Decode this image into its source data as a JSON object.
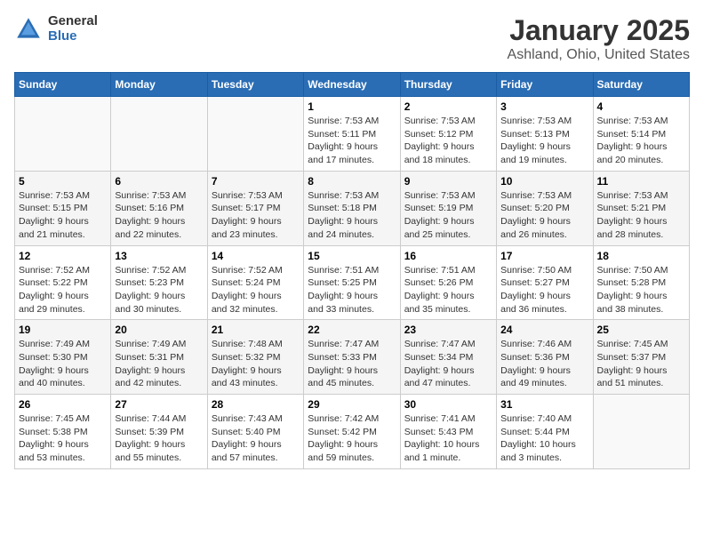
{
  "header": {
    "logo": {
      "general": "General",
      "blue": "Blue"
    },
    "title": "January 2025",
    "subtitle": "Ashland, Ohio, United States"
  },
  "weekdays": [
    "Sunday",
    "Monday",
    "Tuesday",
    "Wednesday",
    "Thursday",
    "Friday",
    "Saturday"
  ],
  "weeks": [
    [
      {
        "day": "",
        "info": ""
      },
      {
        "day": "",
        "info": ""
      },
      {
        "day": "",
        "info": ""
      },
      {
        "day": "1",
        "info": "Sunrise: 7:53 AM\nSunset: 5:11 PM\nDaylight: 9 hours\nand 17 minutes."
      },
      {
        "day": "2",
        "info": "Sunrise: 7:53 AM\nSunset: 5:12 PM\nDaylight: 9 hours\nand 18 minutes."
      },
      {
        "day": "3",
        "info": "Sunrise: 7:53 AM\nSunset: 5:13 PM\nDaylight: 9 hours\nand 19 minutes."
      },
      {
        "day": "4",
        "info": "Sunrise: 7:53 AM\nSunset: 5:14 PM\nDaylight: 9 hours\nand 20 minutes."
      }
    ],
    [
      {
        "day": "5",
        "info": "Sunrise: 7:53 AM\nSunset: 5:15 PM\nDaylight: 9 hours\nand 21 minutes."
      },
      {
        "day": "6",
        "info": "Sunrise: 7:53 AM\nSunset: 5:16 PM\nDaylight: 9 hours\nand 22 minutes."
      },
      {
        "day": "7",
        "info": "Sunrise: 7:53 AM\nSunset: 5:17 PM\nDaylight: 9 hours\nand 23 minutes."
      },
      {
        "day": "8",
        "info": "Sunrise: 7:53 AM\nSunset: 5:18 PM\nDaylight: 9 hours\nand 24 minutes."
      },
      {
        "day": "9",
        "info": "Sunrise: 7:53 AM\nSunset: 5:19 PM\nDaylight: 9 hours\nand 25 minutes."
      },
      {
        "day": "10",
        "info": "Sunrise: 7:53 AM\nSunset: 5:20 PM\nDaylight: 9 hours\nand 26 minutes."
      },
      {
        "day": "11",
        "info": "Sunrise: 7:53 AM\nSunset: 5:21 PM\nDaylight: 9 hours\nand 28 minutes."
      }
    ],
    [
      {
        "day": "12",
        "info": "Sunrise: 7:52 AM\nSunset: 5:22 PM\nDaylight: 9 hours\nand 29 minutes."
      },
      {
        "day": "13",
        "info": "Sunrise: 7:52 AM\nSunset: 5:23 PM\nDaylight: 9 hours\nand 30 minutes."
      },
      {
        "day": "14",
        "info": "Sunrise: 7:52 AM\nSunset: 5:24 PM\nDaylight: 9 hours\nand 32 minutes."
      },
      {
        "day": "15",
        "info": "Sunrise: 7:51 AM\nSunset: 5:25 PM\nDaylight: 9 hours\nand 33 minutes."
      },
      {
        "day": "16",
        "info": "Sunrise: 7:51 AM\nSunset: 5:26 PM\nDaylight: 9 hours\nand 35 minutes."
      },
      {
        "day": "17",
        "info": "Sunrise: 7:50 AM\nSunset: 5:27 PM\nDaylight: 9 hours\nand 36 minutes."
      },
      {
        "day": "18",
        "info": "Sunrise: 7:50 AM\nSunset: 5:28 PM\nDaylight: 9 hours\nand 38 minutes."
      }
    ],
    [
      {
        "day": "19",
        "info": "Sunrise: 7:49 AM\nSunset: 5:30 PM\nDaylight: 9 hours\nand 40 minutes."
      },
      {
        "day": "20",
        "info": "Sunrise: 7:49 AM\nSunset: 5:31 PM\nDaylight: 9 hours\nand 42 minutes."
      },
      {
        "day": "21",
        "info": "Sunrise: 7:48 AM\nSunset: 5:32 PM\nDaylight: 9 hours\nand 43 minutes."
      },
      {
        "day": "22",
        "info": "Sunrise: 7:47 AM\nSunset: 5:33 PM\nDaylight: 9 hours\nand 45 minutes."
      },
      {
        "day": "23",
        "info": "Sunrise: 7:47 AM\nSunset: 5:34 PM\nDaylight: 9 hours\nand 47 minutes."
      },
      {
        "day": "24",
        "info": "Sunrise: 7:46 AM\nSunset: 5:36 PM\nDaylight: 9 hours\nand 49 minutes."
      },
      {
        "day": "25",
        "info": "Sunrise: 7:45 AM\nSunset: 5:37 PM\nDaylight: 9 hours\nand 51 minutes."
      }
    ],
    [
      {
        "day": "26",
        "info": "Sunrise: 7:45 AM\nSunset: 5:38 PM\nDaylight: 9 hours\nand 53 minutes."
      },
      {
        "day": "27",
        "info": "Sunrise: 7:44 AM\nSunset: 5:39 PM\nDaylight: 9 hours\nand 55 minutes."
      },
      {
        "day": "28",
        "info": "Sunrise: 7:43 AM\nSunset: 5:40 PM\nDaylight: 9 hours\nand 57 minutes."
      },
      {
        "day": "29",
        "info": "Sunrise: 7:42 AM\nSunset: 5:42 PM\nDaylight: 9 hours\nand 59 minutes."
      },
      {
        "day": "30",
        "info": "Sunrise: 7:41 AM\nSunset: 5:43 PM\nDaylight: 10 hours\nand 1 minute."
      },
      {
        "day": "31",
        "info": "Sunrise: 7:40 AM\nSunset: 5:44 PM\nDaylight: 10 hours\nand 3 minutes."
      },
      {
        "day": "",
        "info": ""
      }
    ]
  ]
}
